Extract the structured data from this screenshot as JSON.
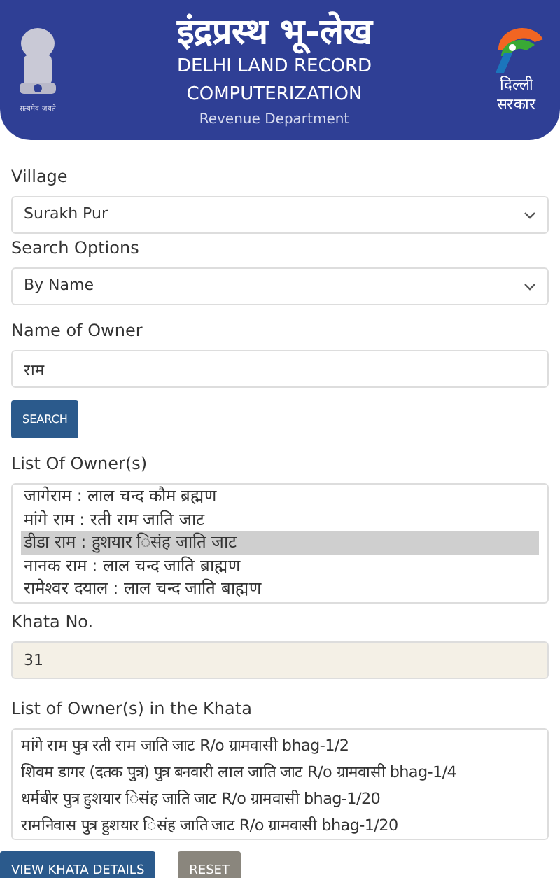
{
  "header": {
    "title": "इंद्रप्रस्थ भू-लेख",
    "subtitle_lines": [
      "DELHI LAND RECORD",
      "COMPUTERIZATION"
    ],
    "department": "Revenue Department",
    "emblem_motto": "सत्यमेव जयते",
    "logo_lines": [
      "दिल्ली",
      "सरकार"
    ]
  },
  "village": {
    "label": "Village",
    "value": "Surakh Pur"
  },
  "search_options": {
    "label": "Search Options",
    "value": "By Name"
  },
  "owner_name": {
    "label": "Name of Owner",
    "value": "राम"
  },
  "search_button": "SEARCH",
  "owners": {
    "label": "List Of Owner(s)",
    "items": [
      {
        "text": "जागेराम : लाल चन्द कौम ब्रह्मण",
        "selected": false
      },
      {
        "text": "मांगे राम : रती राम जाति जाट",
        "selected": false
      },
      {
        "text": "डीडा राम : हुशयार िसंह जाति जाट",
        "selected": true
      },
      {
        "text": "नानक राम : लाल चन्द जाति ब्राह्मण",
        "selected": false
      },
      {
        "text": "रामेश्वर दयाल : लाल चन्द जाति बाह्मण",
        "selected": false
      }
    ]
  },
  "khata_no": {
    "label": "Khata No.",
    "value": "31"
  },
  "khata_owners": {
    "label": "List of Owner(s) in the Khata",
    "lines": [
      "मांगे राम पुत्र रती राम जाति जाट R/o ग्रामवासी bhag-1/2",
      "शिवम डागर (दतक पुत्र) पुत्र बनवारी लाल जाति जाट R/o ग्रामवासी bhag-1/4",
      "धर्मबीर पुत्र हुशयार िसंह जाति जाट R/o ग्रामवासी bhag-1/20",
      "रामनिवास पुत्र हुशयार िसंह जाति जाट R/o ग्रामवासी bhag-1/20"
    ]
  },
  "buttons": [
    {
      "label": "VIEW KHATA DETAILS",
      "kind": "primary"
    },
    {
      "label": "RESET",
      "kind": "secondary"
    }
  ]
}
